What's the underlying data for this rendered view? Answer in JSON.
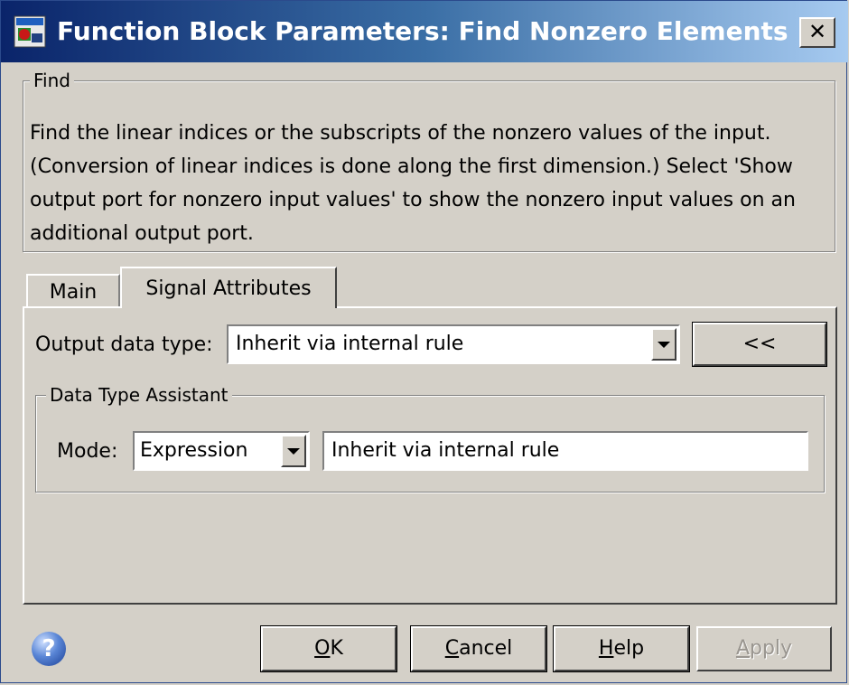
{
  "window": {
    "title": "Function Block Parameters: Find Nonzero Elements",
    "close_label": "✕",
    "app_icon": "simulink-block-icon"
  },
  "find_group": {
    "label": "Find",
    "description": "Find the linear indices or the subscripts of the nonzero values of the input. (Conversion of linear indices is done along the first dimension.) Select 'Show output port for nonzero input values' to show the nonzero input values on an additional output port."
  },
  "tabs": [
    {
      "label": "Main",
      "selected": false
    },
    {
      "label": "Signal Attributes",
      "selected": true
    }
  ],
  "signal_attributes": {
    "output_data_type_label": "Output data type:",
    "output_data_type_value": "Inherit via internal rule",
    "assistant_toggle_label": "<<",
    "assistant_group": {
      "label": "Data Type Assistant",
      "mode_label": "Mode:",
      "mode_value": "Expression",
      "expression_value": "Inherit via internal rule"
    }
  },
  "buttons": {
    "ok": {
      "mnemonic": "O",
      "rest": "K"
    },
    "cancel": {
      "mnemonic": "C",
      "rest": "ancel"
    },
    "help": {
      "mnemonic": "H",
      "rest": "elp"
    },
    "apply": {
      "mnemonic": "A",
      "rest": "pply",
      "enabled": false
    }
  },
  "help_icon": {
    "glyph": "?",
    "icon": "help-question-icon"
  }
}
